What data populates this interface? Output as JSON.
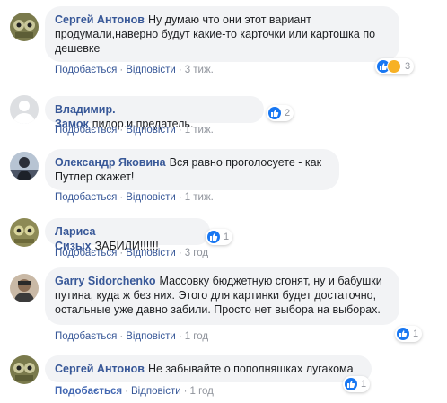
{
  "actions": {
    "like": "Подобається",
    "like_active": "Подобається",
    "reply": "Відповісти",
    "separator": "·"
  },
  "comments": [
    {
      "author": "Сергей Антонов",
      "text": "Ну думаю что они этот вариант продумали,наверно будут какие-то карточки или картошка по дешевке",
      "time": "3 тиж.",
      "reactions": [
        "like-icon",
        "haha-icon"
      ],
      "reaction_count": "3"
    },
    {
      "author": "Владимир. Замок",
      "text": "пидор.и.предатель.",
      "time": "1 тиж.",
      "reactions": [
        "like-icon"
      ],
      "reaction_count": "2"
    },
    {
      "author": "Олександр Яковина",
      "text": "Вся равно проголосуете - как Путлер скажет!",
      "time": "1 тиж."
    },
    {
      "author": "Лариса Сизых",
      "text": "ЗАБИЛИ!!!!!!",
      "time": "3 год",
      "reactions": [
        "like-icon"
      ],
      "reaction_count": "1"
    },
    {
      "author": "Garry Sidorchenko",
      "text": "Массовку бюджетную сгонят, ну и бабушки путина, куда ж без них. Этого для картинки будет достаточно, остальные уже давно забили. Просто нет выбора на выборах.",
      "time": "1 год",
      "reactions": [
        "like-icon"
      ],
      "reaction_count": "1"
    },
    {
      "author": "Сергей Антонов",
      "text": "Не забывайте о пополняшках лугакома",
      "time": "1 год",
      "liked": true,
      "reactions": [
        "like-icon"
      ],
      "reaction_count": "1"
    }
  ],
  "colors": {
    "author": "#385898",
    "bubble": "#f2f3f5",
    "meta": "#90949c",
    "like_blue": "#1877f2"
  }
}
